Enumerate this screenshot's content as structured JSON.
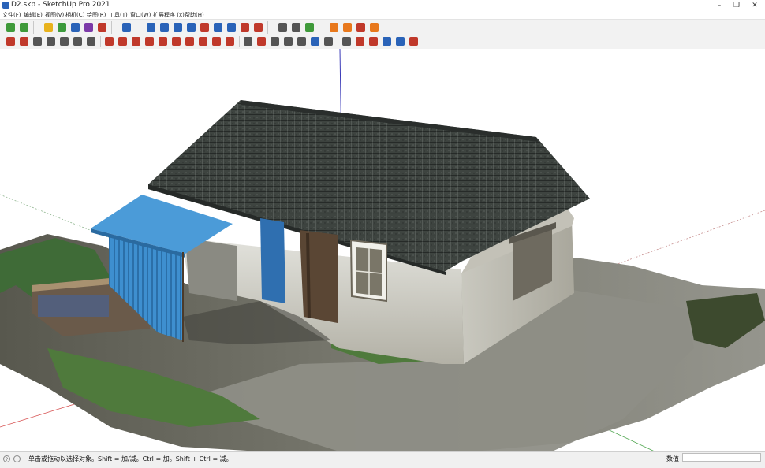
{
  "window": {
    "title": "D2.skp - SketchUp Pro 2021",
    "minimize_glyph": "–",
    "restore_glyph": "❐",
    "close_glyph": "✕"
  },
  "menu": [
    {
      "label": "文件(F)"
    },
    {
      "label": "编辑(E)"
    },
    {
      "label": "视图(V)"
    },
    {
      "label": "相机(C)"
    },
    {
      "label": "绘图(R)"
    },
    {
      "label": "工具(T)"
    },
    {
      "label": "窗口(W)"
    },
    {
      "label": "扩展程序 (x)"
    },
    {
      "label": "帮助(H)"
    }
  ],
  "toolbar_top": [
    {
      "icon": "get-started-icon",
      "color": "#3f9a3a"
    },
    {
      "icon": "select-arrow-icon",
      "color": "#3f9a3a"
    },
    {
      "icon": "house-yellow-icon",
      "color": "#e8b21c"
    },
    {
      "icon": "house-green-icon",
      "color": "#3c9a3c"
    },
    {
      "icon": "house-blue-icon",
      "color": "#2a63b8"
    },
    {
      "icon": "house-purple-icon",
      "color": "#7c3aa8"
    },
    {
      "icon": "geo-location-icon",
      "color": "#c0392b"
    },
    {
      "icon": "sandbox-icon",
      "color": "#2a63b8"
    },
    {
      "icon": "move-layer-icon",
      "color": "#2a63b8"
    },
    {
      "icon": "push-layer-icon",
      "color": "#2a63b8"
    },
    {
      "icon": "section-plane-icon",
      "color": "#2a63b8"
    },
    {
      "icon": "up-down-arrows-icon",
      "color": "#2a63b8"
    },
    {
      "icon": "flip-arrows-icon",
      "color": "#c0392b"
    },
    {
      "icon": "dimension-icon",
      "color": "#2a63b8"
    },
    {
      "icon": "rotate-arc-icon",
      "color": "#2a63b8"
    },
    {
      "icon": "undo-arc-icon",
      "color": "#c0392b"
    },
    {
      "icon": "document-icon",
      "color": "#c0392b"
    },
    {
      "icon": "shield-icon",
      "color": "#555555"
    },
    {
      "icon": "lock-layer-icon",
      "color": "#555555"
    },
    {
      "icon": "leaf-icon",
      "color": "#3f9a3a"
    },
    {
      "icon": "download-tray-icon",
      "color": "#e8781c"
    },
    {
      "icon": "export-tray-icon",
      "color": "#e8781c"
    },
    {
      "icon": "extension-warehouse-icon",
      "color": "#c0392b"
    },
    {
      "icon": "settings-gear-icon",
      "color": "#e8781c"
    }
  ],
  "toolbar_bottom": [
    {
      "icon": "pencil-tool-icon",
      "color": "#c0392b"
    },
    {
      "icon": "push-pull-icon",
      "color": "#c0392b"
    },
    {
      "icon": "offset-tool-icon",
      "color": "#555555"
    },
    {
      "icon": "grid-tool-icon",
      "color": "#555555"
    },
    {
      "icon": "stripes-tool-icon",
      "color": "#555555"
    },
    {
      "icon": "layer-tool-icon",
      "color": "#555555"
    },
    {
      "icon": "hatch-tool-icon",
      "color": "#555555"
    },
    {
      "icon": "line-tool-icon",
      "color": "#c0392b"
    },
    {
      "icon": "arc-tool-icon",
      "color": "#c0392b"
    },
    {
      "icon": "curve-tool-icon",
      "color": "#c0392b"
    },
    {
      "icon": "freehand-tool-icon",
      "color": "#c0392b"
    },
    {
      "icon": "shape-tool-icon",
      "color": "#c0392b"
    },
    {
      "icon": "polygon-tool-icon",
      "color": "#c0392b"
    },
    {
      "icon": "node-tool-icon",
      "color": "#c0392b"
    },
    {
      "icon": "bezier-tool-icon",
      "color": "#c0392b"
    },
    {
      "icon": "eraser-tool-icon",
      "color": "#c0392b"
    },
    {
      "icon": "paint-bucket-icon",
      "color": "#c0392b"
    },
    {
      "icon": "solid-tool-icon",
      "color": "#555555"
    },
    {
      "icon": "scale-tool-icon",
      "color": "#c0392b"
    },
    {
      "icon": "split-tool-icon",
      "color": "#555555"
    },
    {
      "icon": "follow-me-icon",
      "color": "#555555"
    },
    {
      "icon": "intersect-icon",
      "color": "#555555"
    },
    {
      "icon": "outer-shell-icon",
      "color": "#2a63b8"
    },
    {
      "icon": "group-box-icon",
      "color": "#555555"
    },
    {
      "icon": "component-icon",
      "color": "#555555"
    },
    {
      "icon": "brush-tool-icon",
      "color": "#c0392b"
    },
    {
      "icon": "paint-brush-icon",
      "color": "#c0392b"
    },
    {
      "icon": "walk-tool-icon",
      "color": "#2a63b8"
    },
    {
      "icon": "look-around-icon",
      "color": "#2a63b8"
    },
    {
      "icon": "su-plugin-icon",
      "color": "#c0392b"
    }
  ],
  "status": {
    "hint": "单击或拖动以选择对象。Shift = 加/减。Ctrl = 加。Shift + Ctrl = 减。",
    "vcb_label": "数值",
    "vcb_value": "",
    "info_glyph": "i",
    "geo_glyph": "?"
  }
}
